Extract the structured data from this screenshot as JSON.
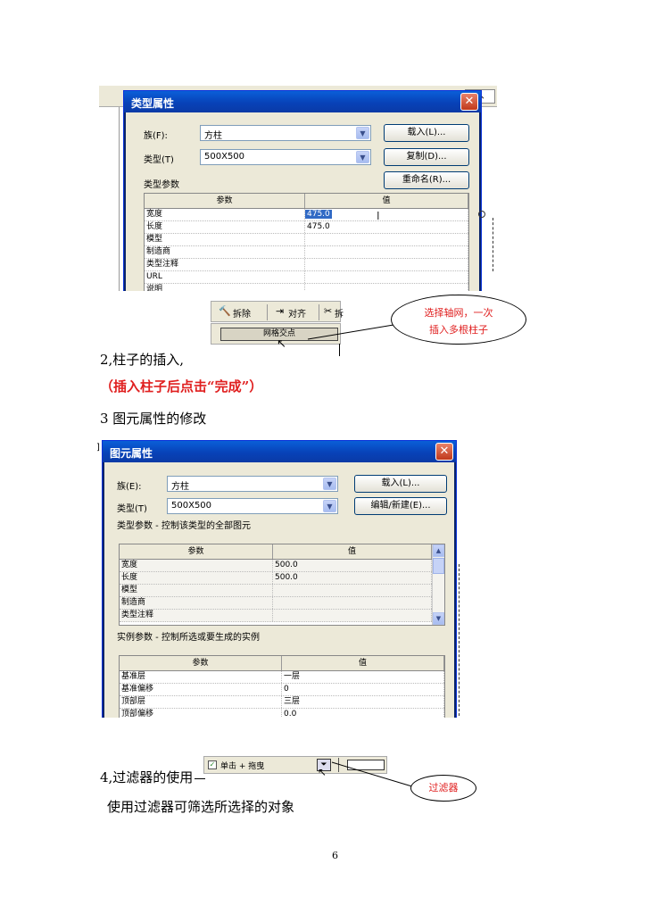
{
  "dialog1": {
    "title": "类型属性",
    "family_label": "族(F):",
    "family_value": "方柱",
    "type_label": "类型(T)",
    "type_value": "500X500",
    "load_button": "载入(L)...",
    "duplicate_button": "复制(D)...",
    "rename_button": "重命名(R)...",
    "type_params_label": "类型参数",
    "columns": [
      "参数",
      "值"
    ],
    "rows": [
      {
        "param": "宽度",
        "value": "475.0"
      },
      {
        "param": "长度",
        "value": "475.0"
      },
      {
        "param": "模型",
        "value": ""
      },
      {
        "param": "制造商",
        "value": ""
      },
      {
        "param": "类型注释",
        "value": ""
      },
      {
        "param": "URL",
        "value": ""
      },
      {
        "param": "说明",
        "value": ""
      }
    ]
  },
  "toolbar1": {
    "items": [
      "拆除",
      "对齐",
      "拆"
    ],
    "grid_intersection_button": "网格交点"
  },
  "callout1": {
    "line1": "选择轴网，一次",
    "line2": "插入多根柱子"
  },
  "section2": "2,柱子的插入,",
  "note_red": "（插入柱子后点击“完成”）",
  "section3": "3 图元属性的修改",
  "dialog2": {
    "title": "图元属性",
    "family_label": "族(E):",
    "family_value": "方柱",
    "type_label": "类型(T)",
    "type_value": "500X500",
    "load_button": "载入(L)...",
    "edit_button": "编辑/新建(E)...",
    "type_params_label": "类型参数 - 控制该类型的全部图元",
    "columns": [
      "参数",
      "值"
    ],
    "type_rows": [
      {
        "param": "宽度",
        "value": "500.0"
      },
      {
        "param": "长度",
        "value": "500.0"
      },
      {
        "param": "模型",
        "value": ""
      },
      {
        "param": "制造商",
        "value": ""
      },
      {
        "param": "类型注释",
        "value": ""
      }
    ],
    "instance_params_label": "实例参数 - 控制所选或要生成的实例",
    "instance_rows": [
      {
        "param": "基准层",
        "value": "一层"
      },
      {
        "param": "基准偏移",
        "value": "0"
      },
      {
        "param": "顶部层",
        "value": "三层"
      },
      {
        "param": "顶部偏移",
        "value": "0.0"
      }
    ]
  },
  "section4": "4,过滤器的使用",
  "toolbar2": {
    "checkbox_label": "单击 + 拖曳"
  },
  "callout2": {
    "text": "过滤器"
  },
  "filter_description": "使用过滤器可筛选所选择的对象",
  "page_number": "6",
  "colors": {
    "red": "#e02020",
    "xp_blue": "#0842b8",
    "dialog_bg": "#ece9d8"
  }
}
